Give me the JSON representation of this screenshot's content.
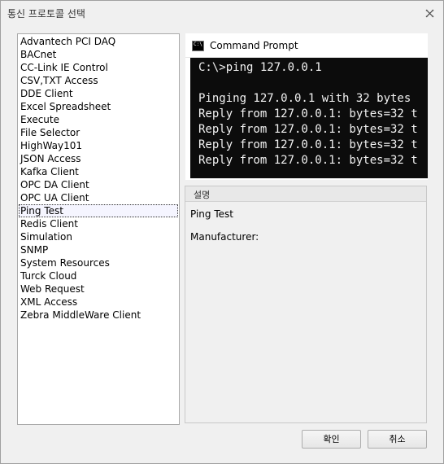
{
  "window": {
    "title": "통신 프로토콜 선택",
    "close_icon": "close-icon"
  },
  "protocols": [
    "Advantech PCI DAQ",
    "BACnet",
    "CC-Link IE Control",
    "CSV,TXT Access",
    "DDE Client",
    "Excel Spreadsheet",
    "Execute",
    "File Selector",
    "HighWay101",
    "JSON Access",
    "Kafka Client",
    "OPC DA Client",
    "OPC UA Client",
    "Ping Test",
    "Redis Client",
    "Simulation",
    "SNMP",
    "System Resources",
    "Turck Cloud",
    "Web Request",
    "XML Access",
    "Zebra MiddleWare Client"
  ],
  "selected_protocol": "Ping Test",
  "preview": {
    "window_title": "Command Prompt",
    "icon_text": "C:\\",
    "lines": [
      "C:\\>ping 127.0.0.1",
      "",
      "Pinging 127.0.0.1 with 32 bytes",
      "Reply from 127.0.0.1: bytes=32 t",
      "Reply from 127.0.0.1: bytes=32 t",
      "Reply from 127.0.0.1: bytes=32 t",
      "Reply from 127.0.0.1: bytes=32 t"
    ]
  },
  "description": {
    "header": "설명",
    "name": "Ping Test",
    "manufacturer_label": "Manufacturer:"
  },
  "buttons": {
    "ok": "확인",
    "cancel": "취소"
  }
}
